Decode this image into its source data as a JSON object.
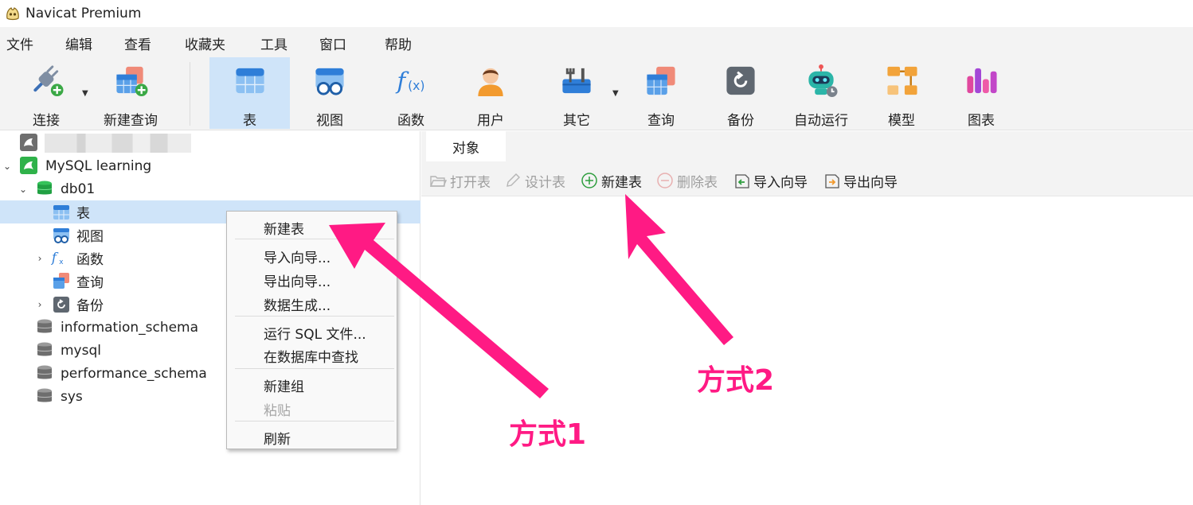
{
  "window": {
    "title": "Navicat Premium"
  },
  "menu": [
    "文件",
    "编辑",
    "查看",
    "收藏夹",
    "工具",
    "窗口",
    "帮助"
  ],
  "toolbar": {
    "connect": "连接",
    "new_query": "新建查询",
    "table": "表",
    "view": "视图",
    "function": "函数",
    "user": "用户",
    "other": "其它",
    "query": "查询",
    "backup": "备份",
    "automation": "自动运行",
    "model": "模型",
    "chart": "图表"
  },
  "tree": {
    "connection": "MySQL learning",
    "database": "db01",
    "children": [
      "表",
      "视图",
      "函数",
      "查询",
      "备份"
    ],
    "other_databases": [
      "information_schema",
      "mysql",
      "performance_schema",
      "sys"
    ]
  },
  "context_menu": {
    "new_table": "新建表",
    "import_wizard": "导入向导...",
    "export_wizard": "导出向导...",
    "data_generation": "数据生成...",
    "run_sql_file": "运行 SQL 文件...",
    "find_in_database": "在数据库中查找",
    "new_group": "新建组",
    "paste": "粘贴",
    "refresh": "刷新"
  },
  "right_pane": {
    "tab": "对象",
    "actions": {
      "open_table": "打开表",
      "design_table": "设计表",
      "new_table": "新建表",
      "delete_table": "删除表",
      "import_wizard": "导入向导",
      "export_wizard": "导出向导"
    }
  },
  "annotations": {
    "method1": "方式1",
    "method2": "方式2"
  },
  "colors": {
    "accent_selected": "#cfe4f9",
    "annotation": "#ff1a84"
  }
}
